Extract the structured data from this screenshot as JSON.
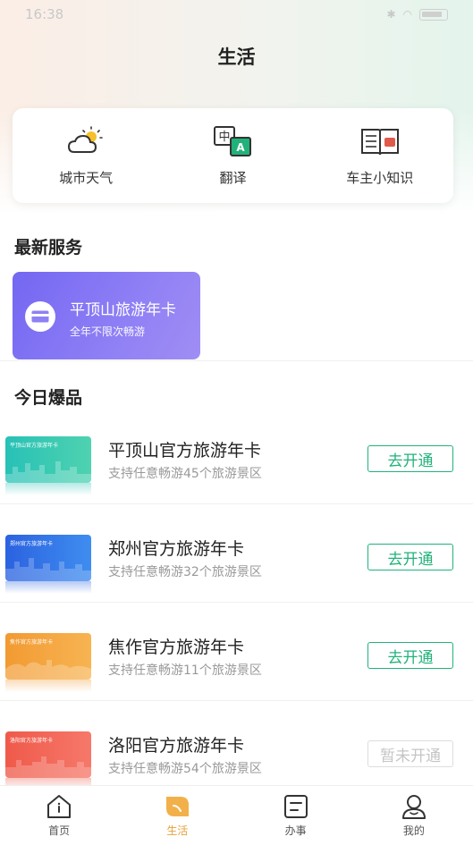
{
  "status_bar": {
    "time": "16:38",
    "battery": "100"
  },
  "page_title": "生活",
  "quick_actions": [
    {
      "label": "城市天气",
      "icon": "weather-icon"
    },
    {
      "label": "翻译",
      "icon": "translate-icon"
    },
    {
      "label": "车主小知识",
      "icon": "book-icon"
    }
  ],
  "sections": {
    "latest": "最新服务",
    "hot": "今日爆品"
  },
  "latest_service": {
    "title": "平顶山旅游年卡",
    "subtitle": "全年不限次畅游",
    "icon": "card-icon"
  },
  "hot_items": [
    {
      "title": "平顶山官方旅游年卡",
      "desc": "支持任意畅游45个旅游景区",
      "action": "去开通",
      "enabled": true,
      "thumb_label": "平顶山官方旅游年卡",
      "thumb_color": "#2fc7b8"
    },
    {
      "title": "郑州官方旅游年卡",
      "desc": "支持任意畅游32个旅游景区",
      "action": "去开通",
      "enabled": true,
      "thumb_label": "郑州官方旅游年卡",
      "thumb_color": "#2f6fe8"
    },
    {
      "title": "焦作官方旅游年卡",
      "desc": "支持任意畅游11个旅游景区",
      "action": "去开通",
      "enabled": true,
      "thumb_label": "焦作官方旅游年卡",
      "thumb_color": "#f5a23c"
    },
    {
      "title": "洛阳官方旅游年卡",
      "desc": "支持任意畅游54个旅游景区",
      "action": "暂未开通",
      "enabled": false,
      "thumb_label": "洛阳官方旅游年卡",
      "thumb_color": "#f2614f"
    }
  ],
  "tabs": [
    {
      "label": "首页",
      "icon": "home-icon",
      "active": false
    },
    {
      "label": "生活",
      "icon": "life-icon",
      "active": true
    },
    {
      "label": "办事",
      "icon": "service-icon",
      "active": false
    },
    {
      "label": "我的",
      "icon": "profile-icon",
      "active": false
    }
  ],
  "colors": {
    "accent_green": "#21b27a",
    "tab_active": "#e8a23a",
    "service_card": "#7467f2"
  }
}
